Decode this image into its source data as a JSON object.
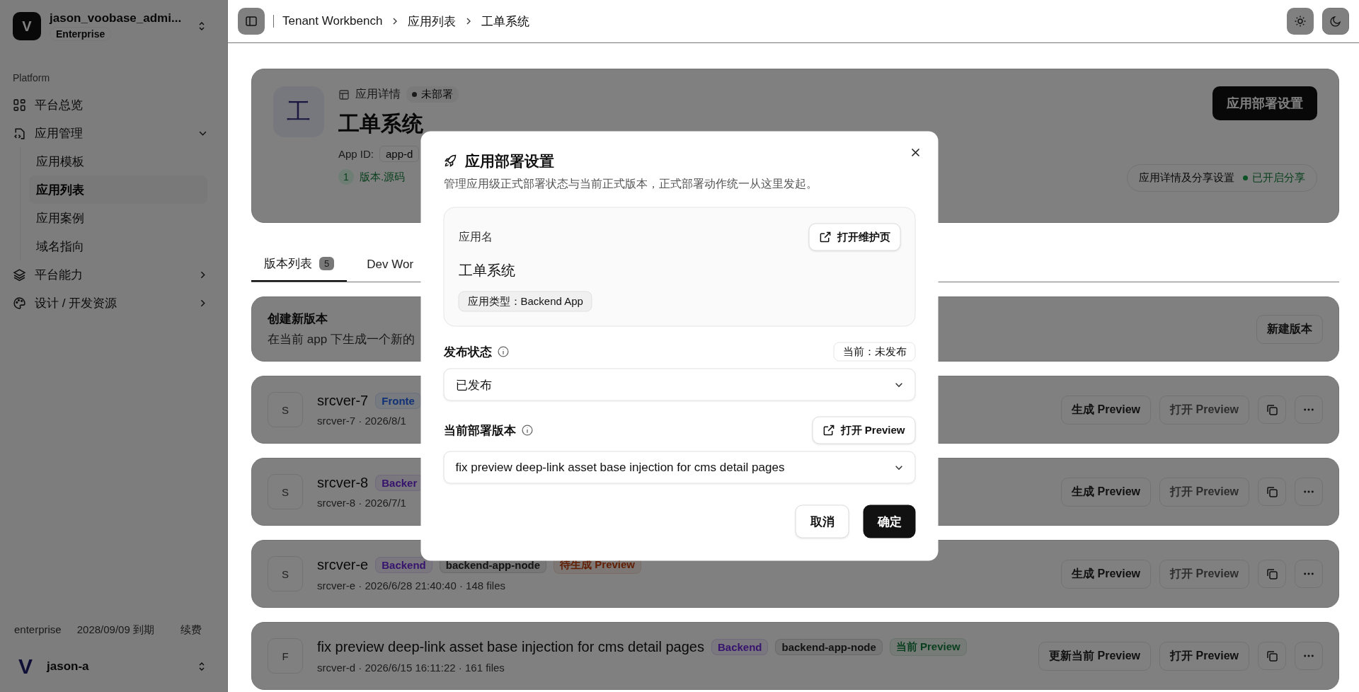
{
  "sidebar": {
    "workspace": {
      "logo": "V",
      "name": "jason_voobase_admi...",
      "plan": "Enterprise"
    },
    "section": "Platform",
    "items": [
      {
        "kind": "link",
        "label": "平台总览"
      },
      {
        "kind": "group",
        "label": "应用管理",
        "expanded": true,
        "children": [
          {
            "label": "应用模板",
            "selected": false
          },
          {
            "label": "应用列表",
            "selected": true
          },
          {
            "label": "应用案例",
            "selected": false
          },
          {
            "label": "域名指向",
            "selected": false
          }
        ]
      },
      {
        "kind": "group",
        "label": "平台能力",
        "expanded": false
      },
      {
        "kind": "group",
        "label": "设计 / 开发资源",
        "expanded": false
      }
    ],
    "footer": {
      "plan": "enterprise",
      "expiry": "2028/09/09 到期",
      "renew": "续费"
    },
    "user": {
      "avatar": "V",
      "name": "jason-a"
    }
  },
  "header": {
    "breadcrumbs": [
      "Tenant Workbench",
      "应用列表",
      "工单系统"
    ]
  },
  "app": {
    "avatar": "工",
    "section": "应用详情",
    "status": "未部署",
    "title": "工单系统",
    "app_id_label": "App ID:",
    "app_id": "app-d",
    "version_count": "1",
    "version_label": "版本.源码",
    "deploy_button": "应用部署设置",
    "share_label": "应用详情及分享设置",
    "share_status": "已开启分享"
  },
  "tabs": [
    {
      "label": "版本列表",
      "count": "5",
      "selected": true
    },
    {
      "label": "Dev Wor",
      "selected": false
    }
  ],
  "create": {
    "title": "创建新版本",
    "description": "在当前 app 下生成一个新的",
    "button": "新建版本"
  },
  "versions": [
    {
      "avatar": "S",
      "title": "srcver-7",
      "tags": [
        {
          "label": "Fronte",
          "kind": "frontend"
        }
      ],
      "meta": "srcver-7 · 2026/8/1",
      "primary": "生成 Preview",
      "open": "打开 Preview",
      "open_disabled": true
    },
    {
      "avatar": "S",
      "title": "srcver-8",
      "tags": [
        {
          "label": "Backer",
          "kind": "backend"
        }
      ],
      "meta": "srcver-8 · 2026/7/1",
      "primary": "生成 Preview",
      "open": "打开 Preview",
      "open_disabled": true
    },
    {
      "avatar": "S",
      "title": "srcver-e",
      "tags": [
        {
          "label": "Backend",
          "kind": "backend"
        },
        {
          "label": "backend-app-node",
          "kind": "runtime"
        },
        {
          "label": "待生成 Preview",
          "kind": "pending"
        }
      ],
      "meta": "srcver-e · 2026/6/28 21:40:40 · 148 files",
      "primary": "生成 Preview",
      "open": "打开 Preview",
      "open_disabled": true
    },
    {
      "avatar": "F",
      "title": "fix preview deep-link asset base injection for cms detail pages",
      "tags": [
        {
          "label": "Backend",
          "kind": "backend"
        },
        {
          "label": "backend-app-node",
          "kind": "runtime"
        },
        {
          "label": "当前 Preview",
          "kind": "current"
        }
      ],
      "meta": "srcver-d · 2026/6/15 16:11:22 · 161 files",
      "primary": "更新当前 Preview",
      "open": "打开 Preview",
      "open_disabled": false
    }
  ],
  "modal": {
    "title": "应用部署设置",
    "description": "管理应用级正式部署状态与当前正式版本，正式部署动作统一从这里发起。",
    "app_card": {
      "label": "应用名",
      "open_button": "打开维护页",
      "name": "工单系统",
      "type_chip": "应用类型：Backend App"
    },
    "publish": {
      "label": "发布状态",
      "current": "当前：未发布",
      "value": "已发布"
    },
    "version": {
      "label": "当前部署版本",
      "open_button": "打开 Preview",
      "value": "fix preview deep-link asset base injection for cms detail pages"
    },
    "cancel": "取消",
    "confirm": "确定"
  }
}
